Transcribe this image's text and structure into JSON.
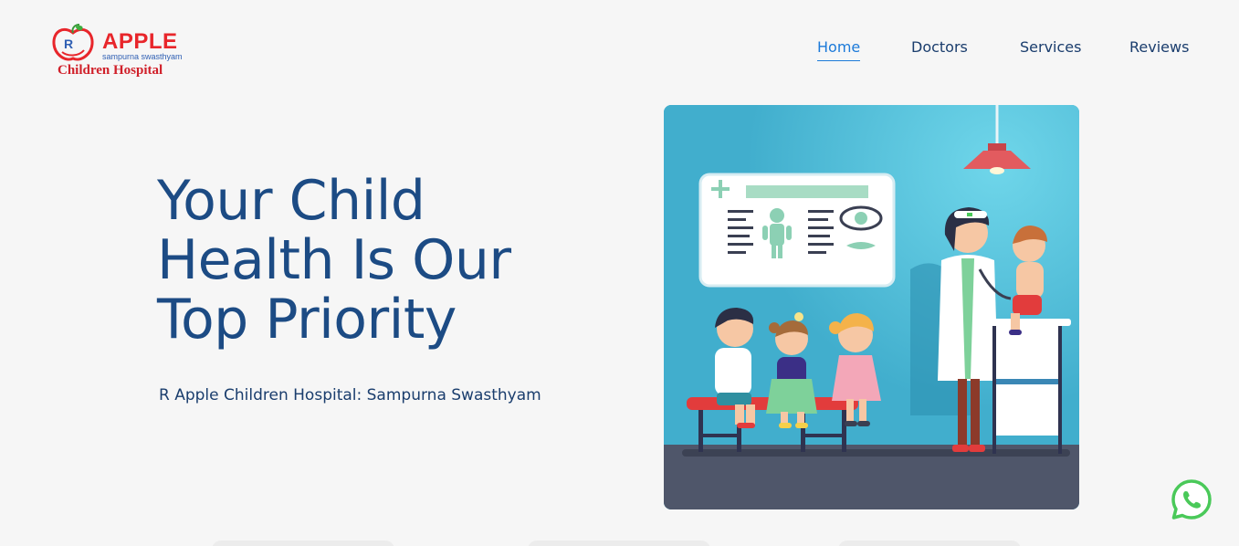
{
  "brand": {
    "word": "APPLE",
    "tagline": "sampurna swasthyam",
    "name": "Children Hospital"
  },
  "nav": {
    "items": [
      {
        "label": "Home",
        "active": true
      },
      {
        "label": "Doctors",
        "active": false
      },
      {
        "label": "Services",
        "active": false
      },
      {
        "label": "Reviews",
        "active": false
      }
    ]
  },
  "hero": {
    "title": "Your Child Health Is Our Top Priority",
    "subtitle": "R Apple Children Hospital: Sampurna Swasthyam"
  },
  "colors": {
    "brand_red": "#e8262b",
    "heading_blue": "#1c4b84",
    "nav_active": "#1c7ad9",
    "whatsapp_green": "#4ac959",
    "illustration_bg": "#41aecd"
  },
  "icons": {
    "whatsapp": "whatsapp-icon",
    "logo": "apple-logo-icon"
  }
}
